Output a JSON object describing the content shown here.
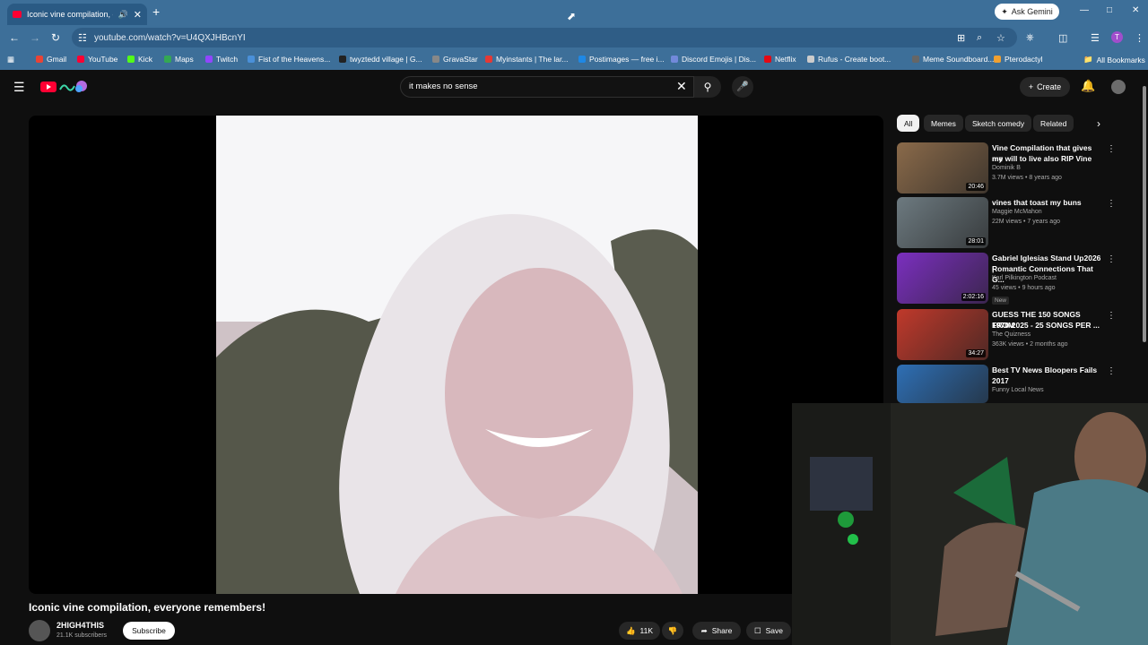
{
  "browser": {
    "tab_title": "Iconic vine compilation, ev...",
    "url": "youtube.com/watch?v=U4QXJHBcnYI",
    "ask_gemini": "Ask Gemini",
    "all_bookmarks": "All Bookmarks",
    "profile_initial": "T",
    "bookmarks": [
      {
        "label": "Gmail",
        "color": "#ea4335"
      },
      {
        "label": "YouTube",
        "color": "#ff0033"
      },
      {
        "label": "Kick",
        "color": "#53fc18"
      },
      {
        "label": "Maps",
        "color": "#34a853"
      },
      {
        "label": "Twitch",
        "color": "#9146ff"
      },
      {
        "label": "Fist of the Heavens...",
        "color": "#4a90d9"
      },
      {
        "label": "twyztedd village | G...",
        "color": "#222222"
      },
      {
        "label": "GravaStar",
        "color": "#888888"
      },
      {
        "label": "Myinstants | The lar...",
        "color": "#e53935"
      },
      {
        "label": "Postimages — free i...",
        "color": "#1e88e5"
      },
      {
        "label": "Discord Emojis | Dis...",
        "color": "#7289da"
      },
      {
        "label": "Netflix",
        "color": "#e50914"
      },
      {
        "label": "Rufus - Create boot...",
        "color": "#cccccc"
      },
      {
        "label": "Meme Soundboard...",
        "color": "#666666"
      },
      {
        "label": "Pterodactyl",
        "color": "#f0a030"
      }
    ]
  },
  "youtube": {
    "search_query": "it makes no sense",
    "create_label": "Create",
    "video_title": "Iconic vine compilation, everyone remembers!",
    "channel_name": "2HIGH4THIS",
    "channel_subs": "21.1K subscribers",
    "subscribe_label": "Subscribe",
    "likes": "11K",
    "share_label": "Share",
    "save_label": "Save",
    "chips": [
      "All",
      "Memes",
      "Sketch comedy",
      "Related"
    ],
    "recommendations": [
      {
        "title_line1": "Vine Compilation that gives me",
        "title_line2": "my will to live also RIP Vine",
        "channel": "Dominik B",
        "meta": "3.7M views • 8 years ago",
        "duration": "20:46",
        "thumb_color": "#8a6a4a"
      },
      {
        "title_line1": "vines that toast my buns",
        "title_line2": "",
        "channel": "Maggie McMahon",
        "meta": "22M views • 7 years ago",
        "duration": "28:01",
        "thumb_color": "#6d7a80"
      },
      {
        "title_line1": "Gabriel Iglesias Stand Up2026 |",
        "title_line2": "Romantic Connections That G...",
        "channel": "Karl Pilkington Podcast",
        "meta": "45 views • 9 hours ago",
        "duration": "2:02:16",
        "thumb_color": "#7b2fbf",
        "badge": "New"
      },
      {
        "title_line1": "GUESS THE 150 SONGS FROM",
        "title_line2": "1970-2025 - 25 SONGS PER ...",
        "channel": "The Quizness",
        "meta": "363K views • 2 months ago",
        "duration": "34:27",
        "thumb_color": "#c0392b"
      },
      {
        "title_line1": "Best TV News Bloopers Fails",
        "title_line2": "2017",
        "channel": "Funny Local News",
        "meta": "",
        "duration": "",
        "thumb_color": "#2e6fb5"
      }
    ]
  }
}
